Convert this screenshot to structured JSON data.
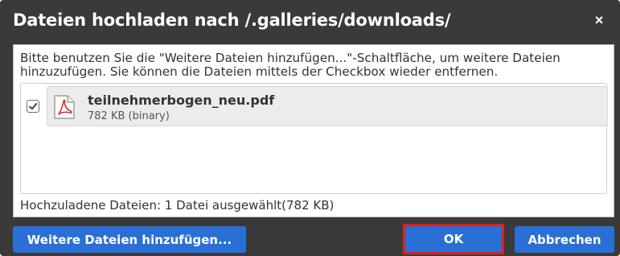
{
  "dialog": {
    "title": "Dateien hochladen nach /.galleries/downloads/",
    "close_label": "×",
    "instructions": "Bitte benutzen Sie die \"Weitere Dateien hinzufügen...\"-Schaltfläche, um weitere Dateien hinzuzufügen. Sie können die Dateien mittels der Checkbox wieder entfernen.",
    "files": [
      {
        "name": "teilnehmerbogen_neu.pdf",
        "meta": "782 KB (binary)",
        "checked": true,
        "icon": "pdf-file-icon"
      }
    ],
    "summary": "Hochzuladene Dateien: 1 Datei ausgewählt(782 KB)",
    "buttons": {
      "more_label": "Weitere Dateien hinzufügen...",
      "ok_label": "OK",
      "cancel_label": "Abbrechen"
    }
  },
  "colors": {
    "titlebar": "#3a3a3a",
    "button": "#2a6fd6",
    "highlight": "#e0201b",
    "pdf_red": "#d0312d"
  }
}
